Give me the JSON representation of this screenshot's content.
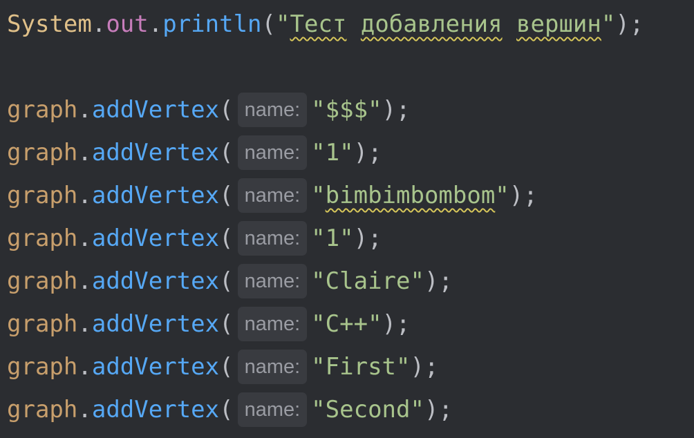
{
  "code": {
    "println_line": {
      "receiver": "System",
      "dot1": ".",
      "field": "out",
      "dot2": ".",
      "method": "println",
      "open": "(",
      "quote_open": "\"",
      "word1": "Тест",
      "space1": " ",
      "word2": "добавления",
      "space2": " ",
      "word3": "вершин",
      "quote_close": "\"",
      "close": ");"
    },
    "vertex_calls": [
      {
        "receiver": "graph",
        "dot": ".",
        "method": "addVertex",
        "open": "(",
        "hint": "name:",
        "quote_open": "\"",
        "value": "$$$",
        "quote_close": "\"",
        "close": ");"
      },
      {
        "receiver": "graph",
        "dot": ".",
        "method": "addVertex",
        "open": "(",
        "hint": "name:",
        "quote_open": "\"",
        "value": "1",
        "quote_close": "\"",
        "close": ");"
      },
      {
        "receiver": "graph",
        "dot": ".",
        "method": "addVertex",
        "open": "(",
        "hint": "name:",
        "quote_open": "\"",
        "value": "bimbimbombom",
        "quote_close": "\"",
        "close": ");"
      },
      {
        "receiver": "graph",
        "dot": ".",
        "method": "addVertex",
        "open": "(",
        "hint": "name:",
        "quote_open": "\"",
        "value": "1",
        "quote_close": "\"",
        "close": ");"
      },
      {
        "receiver": "graph",
        "dot": ".",
        "method": "addVertex",
        "open": "(",
        "hint": "name:",
        "quote_open": "\"",
        "value": "Claire",
        "quote_close": "\"",
        "close": ");"
      },
      {
        "receiver": "graph",
        "dot": ".",
        "method": "addVertex",
        "open": "(",
        "hint": "name:",
        "quote_open": "\"",
        "value": "C++",
        "quote_close": "\"",
        "close": ");"
      },
      {
        "receiver": "graph",
        "dot": ".",
        "method": "addVertex",
        "open": "(",
        "hint": "name:",
        "quote_open": "\"",
        "value": "First",
        "quote_close": "\"",
        "close": ");"
      },
      {
        "receiver": "graph",
        "dot": ".",
        "method": "addVertex",
        "open": "(",
        "hint": "name:",
        "quote_open": "\"",
        "value": "Second",
        "quote_close": "\"",
        "close": ");"
      }
    ]
  },
  "colors": {
    "background": "#2b2d31",
    "class_name": "#e0c089",
    "field": "#c77dbb",
    "method": "#56a8f5",
    "local_variable": "#c89f6c",
    "string": "#a8c48c",
    "punctuation": "#bcbec4",
    "inlay_hint_bg": "#393b40",
    "inlay_hint_text": "#9a9ca3",
    "typo_underline": "#d6c65a"
  }
}
